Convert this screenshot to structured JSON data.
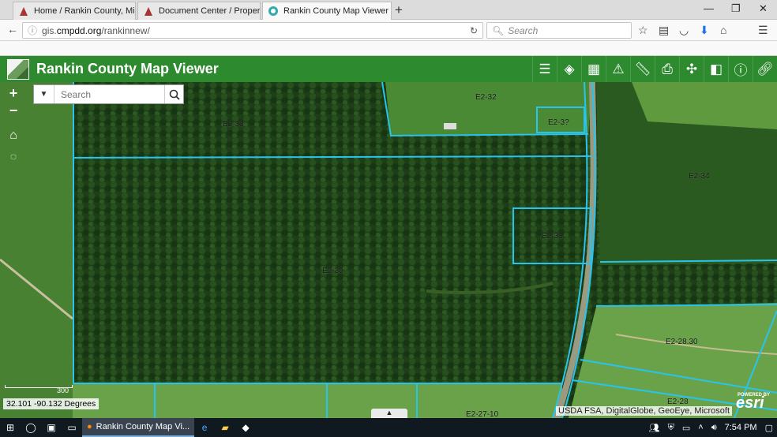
{
  "browser": {
    "tabs": [
      {
        "title": "Home / Rankin County, Miss",
        "icon": "page-icon"
      },
      {
        "title": "Document Center / Property",
        "icon": "page-icon"
      },
      {
        "title": "Rankin County Map Viewer",
        "icon": "map-favicon"
      }
    ],
    "url_prefix": "gis.",
    "url_domain": "cmpdd.org",
    "url_path": "/rankinnew/",
    "search_placeholder": "Search"
  },
  "app": {
    "title": "Rankin County Map Viewer",
    "tools": [
      "legend-icon",
      "layers-icon",
      "basemap-icon",
      "alert-icon",
      "measure-icon",
      "print-icon",
      "identify-icon",
      "compare-icon",
      "info-icon",
      "link-icon"
    ]
  },
  "map": {
    "search_placeholder": "Search",
    "zoom_in": "+",
    "zoom_out": "−",
    "coords": "32.101 -90.132 Degrees",
    "scale_label": "300",
    "attribution": "USDA FSA, DigitalGlobe, GeoEye, Microsoft",
    "esri_powered": "POWERED BY",
    "esri_brand": "esri",
    "parcels": [
      {
        "id": "p1",
        "label": "E2-32"
      },
      {
        "id": "p2",
        "label": "E2-33"
      },
      {
        "id": "p3",
        "label": "E2-3?"
      },
      {
        "id": "p4",
        "label": "E2-34"
      },
      {
        "id": "p5",
        "label": "E2-31"
      },
      {
        "id": "p6",
        "label": "E2-30"
      },
      {
        "id": "p7",
        "label": "E2-28.30"
      },
      {
        "id": "p8",
        "label": "E2-28"
      },
      {
        "id": "p9",
        "label": "E2-27-10"
      }
    ]
  },
  "taskbar": {
    "app_label": "Rankin County Map Vi...",
    "time": "7:54 PM"
  }
}
